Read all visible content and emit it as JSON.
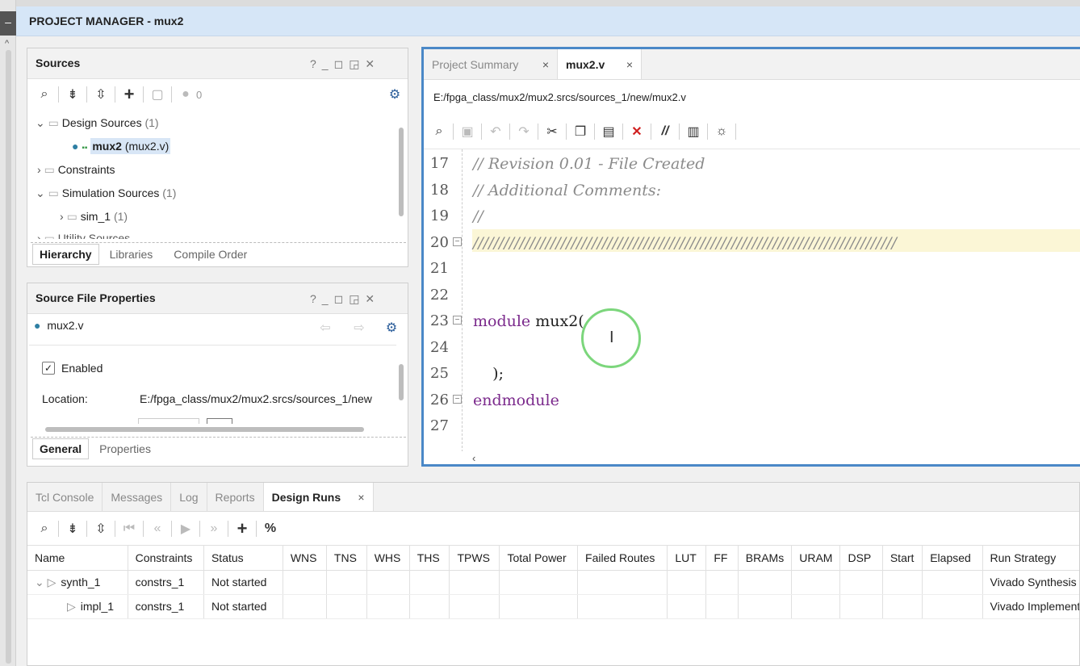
{
  "window": {
    "title": "PROJECT MANAGER - mux2"
  },
  "sources": {
    "title": "Sources",
    "toolbar": {
      "count": "0"
    },
    "tree": [
      {
        "label": "Design Sources",
        "count": "(1)"
      },
      {
        "name": "mux2",
        "detail": "(mux2.v)"
      },
      {
        "label": "Constraints"
      },
      {
        "label": "Simulation Sources",
        "count": "(1)"
      },
      {
        "label": "sim_1",
        "count": "(1)"
      },
      {
        "label": "Utility Sources"
      }
    ],
    "tabs": [
      "Hierarchy",
      "Libraries",
      "Compile Order"
    ]
  },
  "props": {
    "title": "Source File Properties",
    "file": "mux2.v",
    "enabled_label": "Enabled",
    "location_label": "Location:",
    "location_value": "E:/fpga_class/mux2/mux2.srcs/sources_1/new",
    "tabs": [
      "General",
      "Properties"
    ]
  },
  "editor": {
    "tabs": [
      "Project Summary",
      "mux2.v"
    ],
    "path": "E:/fpga_class/mux2/mux2.srcs/sources_1/new/mux2.v",
    "lines": [
      {
        "n": "17",
        "text": "// Revision 0.01 - File Created"
      },
      {
        "n": "18",
        "text": "// Additional Comments:"
      },
      {
        "n": "19",
        "text": "//"
      },
      {
        "n": "20",
        "text": "//////////////////////////////////////////////////////////////////////////////////"
      },
      {
        "n": "21",
        "text": ""
      },
      {
        "n": "22",
        "text": ""
      },
      {
        "n": "23",
        "kw": "module",
        "text": " mux2("
      },
      {
        "n": "24",
        "text": ""
      },
      {
        "n": "25",
        "text": "    );"
      },
      {
        "n": "26",
        "kw": "endmodule",
        "text": ""
      },
      {
        "n": "27",
        "text": ""
      }
    ]
  },
  "bottom": {
    "tabs": [
      "Tcl Console",
      "Messages",
      "Log",
      "Reports",
      "Design Runs"
    ],
    "columns": [
      "Name",
      "Constraints",
      "Status",
      "WNS",
      "TNS",
      "WHS",
      "THS",
      "TPWS",
      "Total Power",
      "Failed Routes",
      "LUT",
      "FF",
      "BRAMs",
      "URAM",
      "DSP",
      "Start",
      "Elapsed",
      "Run Strategy"
    ],
    "rows": [
      {
        "name": "synth_1",
        "constraints": "constrs_1",
        "status": "Not started",
        "strategy": "Vivado Synthesis Defaults"
      },
      {
        "name": "impl_1",
        "constraints": "constrs_1",
        "status": "Not started",
        "strategy": "Vivado Implementation Defaults"
      }
    ]
  }
}
